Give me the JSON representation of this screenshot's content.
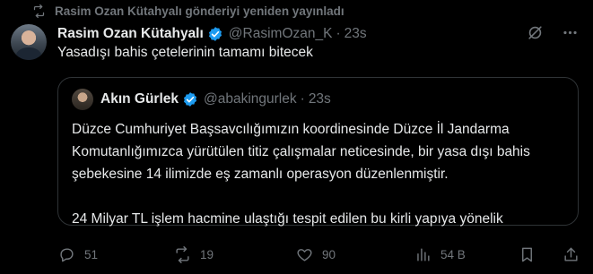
{
  "repost_banner": {
    "text": "Rasim Ozan Kütahyalı gönderiyi yeniden yayınladı"
  },
  "tweet": {
    "name": "Rasim Ozan Kütahyalı",
    "handle": "@RasimOzan_K",
    "separator": "·",
    "time": "23s",
    "text": "Yasadışı bahis çetelerinin tamamı bitecek"
  },
  "quote": {
    "name": "Akın Gürlek",
    "handle": "@abakingurlek",
    "separator": "·",
    "time": "23s",
    "paragraph_1": "Düzce Cumhuriyet Başsavcılığımızın koordinesinde Düzce İl Jandarma Komutanlığımızca yürütülen titiz çalışmalar neticesinde, bir yasa dışı bahis şebekesine 14 ilimizde eş zamanlı operasyon düzenlenmiştir.",
    "paragraph_2": "24 Milyar TL işlem hacmine ulaştığı tespit edilen bu kirli yapıya yönelik"
  },
  "actions": {
    "replies": "51",
    "reposts": "19",
    "likes": "90",
    "views": "54 B"
  },
  "icons": {
    "repost_banner": "repost-icon",
    "verified": "verified-badge-icon",
    "grok": "grok-icon",
    "more": "more-icon",
    "reply": "reply-icon",
    "repost": "repost-icon",
    "like": "heart-icon",
    "views": "views-icon",
    "bookmark": "bookmark-icon",
    "share": "share-icon"
  },
  "colors": {
    "background": "#000000",
    "text": "#e7e9ea",
    "muted": "#71767b",
    "verified": "#1d9bf0",
    "border": "#2f3336"
  }
}
